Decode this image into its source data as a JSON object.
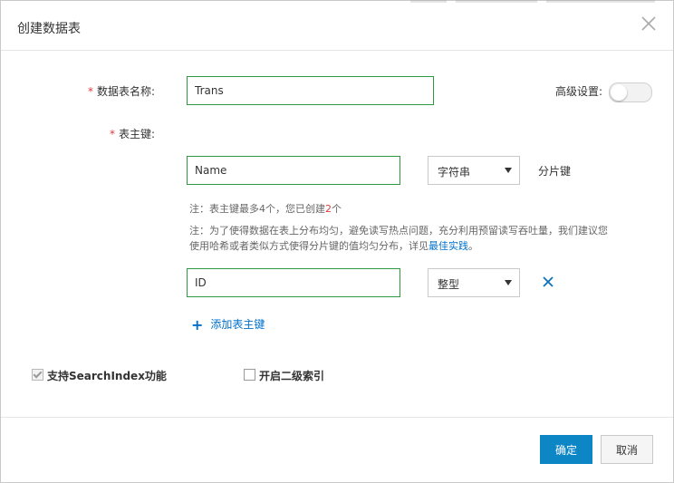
{
  "dialog": {
    "title": "创建数据表"
  },
  "form": {
    "table_name_label": "数据表名称:",
    "table_name_value": "Trans",
    "advanced_label": "高级设置:",
    "primary_key_label": "表主键:",
    "primary_keys": [
      {
        "name": "Name",
        "type": "字符串",
        "tag": "分片键"
      },
      {
        "name": "ID",
        "type": "整型"
      }
    ],
    "note1_prefix": "注：表主键最多4个，您已创建",
    "note1_count": "2",
    "note1_suffix": "个",
    "note2_line1": "注：为了使得数据在表上分布均匀，避免读写热点问题，充分利用预留读写吞吐量，我们建议您",
    "note2_line2": "使用哈希或者类似方式使得分片键的值均匀分布，详见",
    "note2_link": "最佳实践",
    "note2_end": "。",
    "add_key_label": "添加表主键",
    "search_index_label": "支持SearchIndex功能",
    "secondary_index_label": "开启二级索引",
    "search_index_checked": true,
    "secondary_index_checked": false
  },
  "footer": {
    "ok_label": "确定",
    "cancel_label": "取消"
  },
  "colors": {
    "primary": "#0d86c5",
    "required": "#e4393c",
    "input_border": "#2e9a3f",
    "link": "#0070cc"
  }
}
